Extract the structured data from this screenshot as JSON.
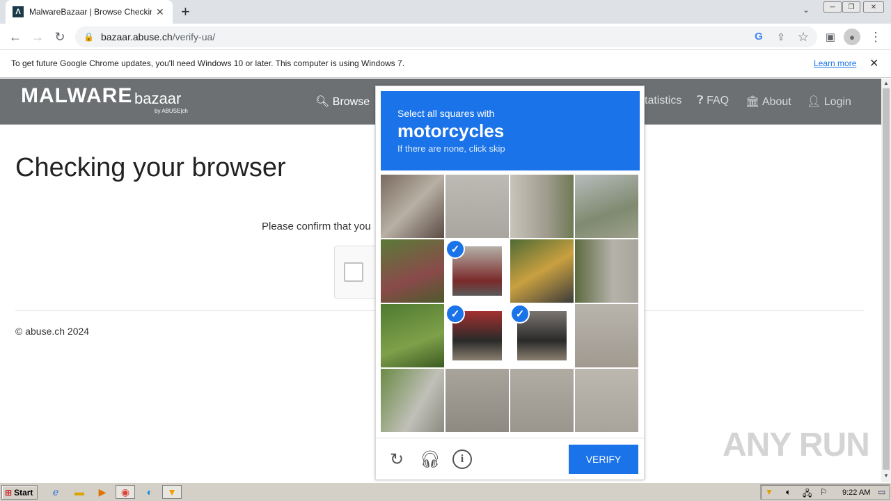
{
  "browser": {
    "tab_title": "MalwareBazaar | Browse Checking y",
    "tab_favicon": "Λ",
    "new_tab": "+",
    "url_host": "bazaar.abuse.ch",
    "url_path": "/verify-ua/",
    "infobar_message": "To get future Google Chrome updates, you'll need Windows 10 or later. This computer is using Windows 7.",
    "infobar_link": "Learn more"
  },
  "site": {
    "logo_main": "MALWARE",
    "logo_sub": "bazaar",
    "logo_by": "by ABUSE|ch",
    "nav": {
      "browse": "Browse",
      "statistics": "tatistics",
      "faq": "FAQ",
      "about": "About",
      "login": "Login"
    },
    "heading": "Checking your browser",
    "confirm_text": "Please confirm that you",
    "footer": "© abuse.ch 2024"
  },
  "captcha": {
    "line1": "Select all squares with",
    "target": "motorcycles",
    "line3": "If there are none, click skip",
    "verify_label": "VERIFY",
    "selected_tiles": [
      5,
      9,
      10
    ],
    "accent_color": "#1a73e8"
  },
  "watermark": "ANY RUN",
  "taskbar": {
    "start_label": "Start",
    "clock": "9:22 AM"
  }
}
